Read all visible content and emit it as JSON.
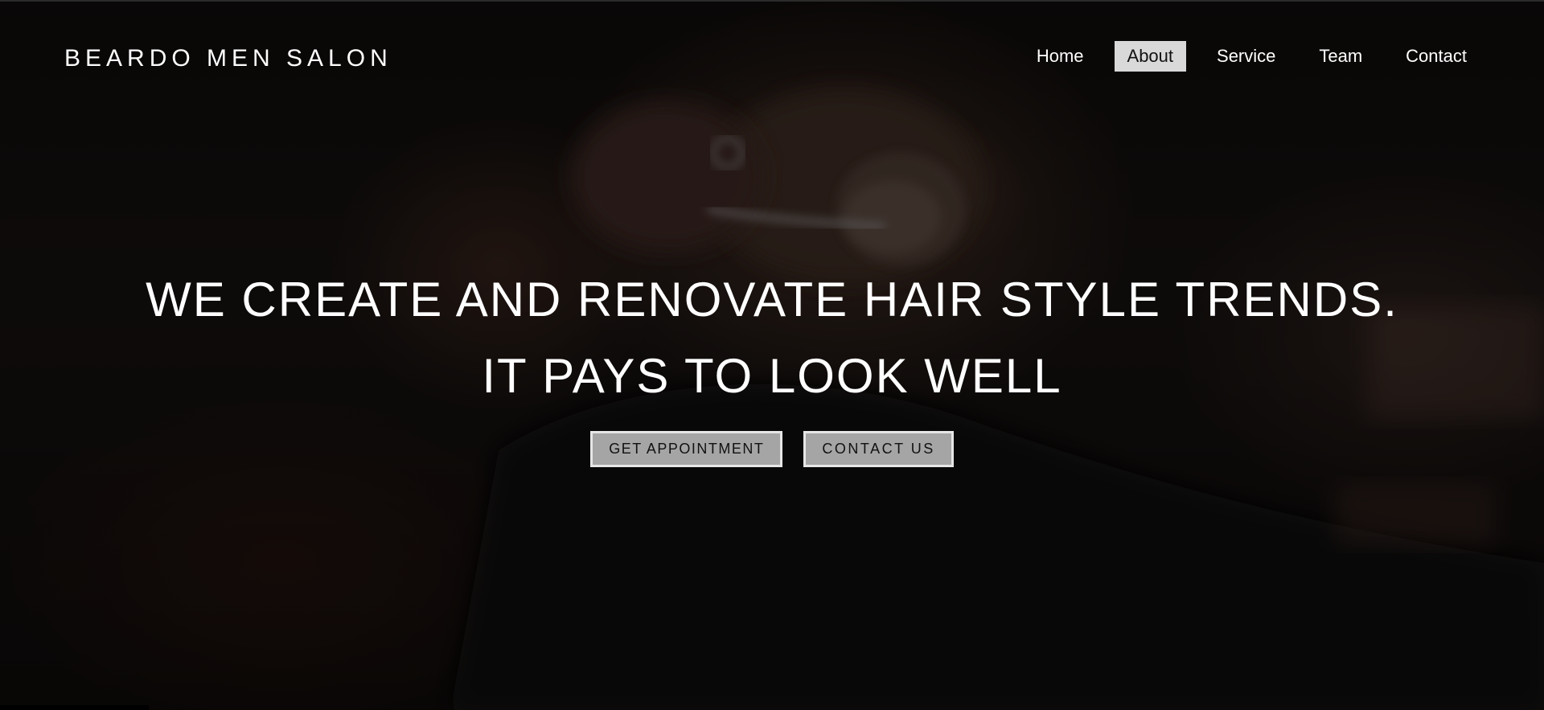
{
  "brand": {
    "name": "BEARDO MEN SALON"
  },
  "nav": {
    "items": [
      {
        "label": "Home",
        "active": false
      },
      {
        "label": "About",
        "active": true
      },
      {
        "label": "Service",
        "active": false
      },
      {
        "label": "Team",
        "active": false
      },
      {
        "label": "Contact",
        "active": false
      }
    ]
  },
  "hero": {
    "line1": "WE CREATE AND RENOVATE HAIR STYLE TRENDS.",
    "line2": "IT PAYS TO LOOK WELL",
    "buttons": {
      "appointment": "GET APPOINTMENT",
      "contact": "CONTACT US"
    }
  },
  "colors": {
    "background": "#0b0908",
    "text": "#ffffff",
    "nav_active_bg": "#d9d9d9",
    "button_bg": "#a5a5a5",
    "button_border": "#e6e6e6"
  }
}
